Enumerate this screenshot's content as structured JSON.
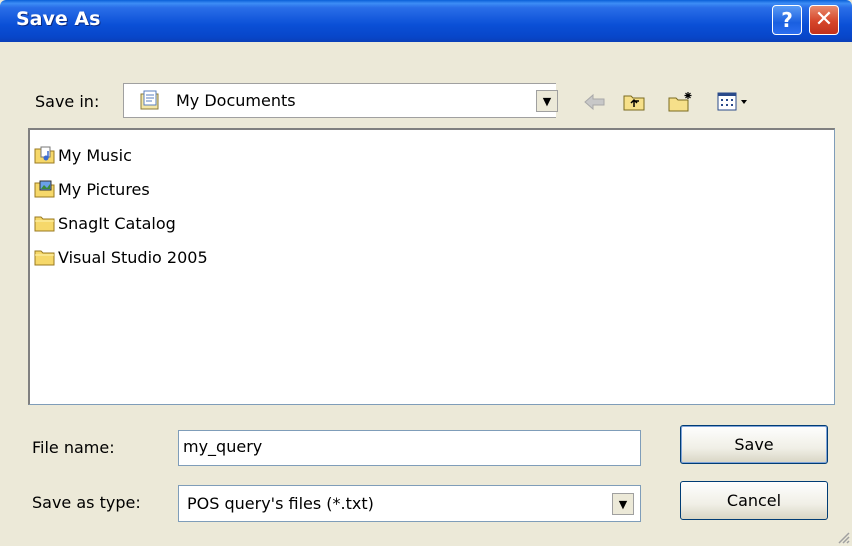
{
  "window": {
    "title": "Save As",
    "help_label": "?",
    "close_label": "✕"
  },
  "toolbar": {
    "save_in_label": "Save in:",
    "location": "My Documents",
    "dropdown_arrow": "▼"
  },
  "files": [
    {
      "name": "My Music",
      "icon": "music-folder-icon"
    },
    {
      "name": "My Pictures",
      "icon": "pictures-folder-icon"
    },
    {
      "name": "SnagIt Catalog",
      "icon": "folder-icon"
    },
    {
      "name": "Visual Studio 2005",
      "icon": "folder-icon"
    }
  ],
  "form": {
    "file_name_label": "File name:",
    "file_name_value": "my_query",
    "save_type_label": "Save as type:",
    "save_type_value": "POS query's files (*.txt)",
    "dropdown_arrow": "▼"
  },
  "buttons": {
    "save": "Save",
    "cancel": "Cancel"
  },
  "colors": {
    "titlebar": "#0a4fd6",
    "dialog_bg": "#ece9d8",
    "border": "#7f9db9"
  }
}
